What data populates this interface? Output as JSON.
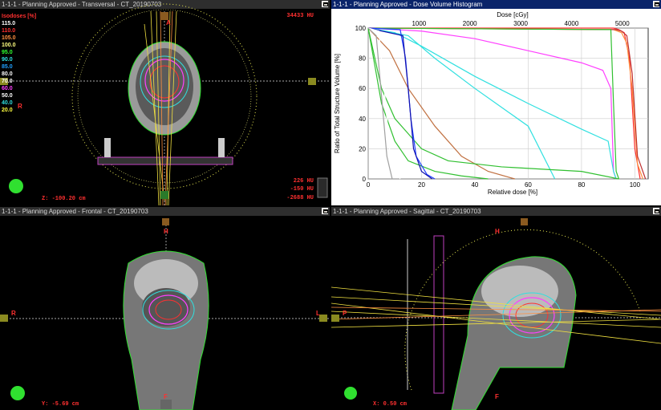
{
  "panels": {
    "transversal": {
      "title": "1-1-1 - Planning Approved - Transversal - CT_20190703",
      "hu_top": "34433 HU",
      "hu1": "226 HU",
      "hu2": "-150 HU",
      "hu3": "-2688 HU",
      "pos": "Z: -100.20 cm",
      "ant": "A",
      "post": "P",
      "right": "R"
    },
    "dvh": {
      "title": "1-1-1 - Planning Approved - Dose Volume Histogram"
    },
    "frontal": {
      "title": "1-1-1 - Planning Approved - Frontal - CT_20190703",
      "pos": "Y: -5.69 cm",
      "top": "H",
      "bottom": "F",
      "left": "R",
      "right": "L"
    },
    "sagittal": {
      "title": "1-1-1 - Planning Approved - Sagittal - CT_20190703",
      "pos": "X: 0.50 cm",
      "top": "H",
      "bottom": "F",
      "left": "P"
    }
  },
  "isodoses": {
    "header": "Isodoses [%]",
    "levels": [
      {
        "v": "115.0",
        "c": "#ffffff"
      },
      {
        "v": "110.0",
        "c": "#ff3030"
      },
      {
        "v": "105.0",
        "c": "#ff9040"
      },
      {
        "v": "100.0",
        "c": "#ffff80"
      },
      {
        "v": "95.0",
        "c": "#30ff30"
      },
      {
        "v": "90.0",
        "c": "#30e0e0"
      },
      {
        "v": "85.0",
        "c": "#20a0ff"
      },
      {
        "v": "80.0",
        "c": "#ffffff"
      },
      {
        "v": "70.0",
        "c": "#ffffff"
      },
      {
        "v": "60.0",
        "c": "#ff40ff"
      },
      {
        "v": "50.0",
        "c": "#ffffff"
      },
      {
        "v": "40.0",
        "c": "#30e0e0"
      },
      {
        "v": "20.0",
        "c": "#ffff40"
      }
    ]
  },
  "chart_data": {
    "type": "line",
    "xlabel": "Relative dose [%]",
    "ylabel": "Ratio of Total Structure Volume [%]",
    "x2label": "Dose [cGy]",
    "xlim": [
      0,
      105
    ],
    "ylim": [
      0,
      100
    ],
    "x_ticks": [
      0,
      20,
      40,
      60,
      80,
      100
    ],
    "y_ticks": [
      0,
      20,
      40,
      60,
      80,
      100
    ],
    "x2_ticks": [
      1000,
      2000,
      3000,
      4000,
      5000
    ],
    "series": [
      {
        "color": "#ff3030",
        "x": [
          0,
          92,
          94,
          96,
          98,
          100,
          102
        ],
        "y": [
          100,
          100,
          99,
          97,
          80,
          20,
          0
        ]
      },
      {
        "color": "#ff9040",
        "x": [
          0,
          92,
          95,
          97,
          99,
          101,
          103
        ],
        "y": [
          100,
          99,
          97,
          90,
          60,
          10,
          0
        ]
      },
      {
        "color": "#c03030",
        "x": [
          0,
          93,
          95,
          97,
          99,
          101,
          104
        ],
        "y": [
          100,
          99,
          98,
          95,
          70,
          15,
          0
        ]
      },
      {
        "color": "#30c030",
        "x": [
          0,
          91,
          92,
          93,
          94
        ],
        "y": [
          100,
          99,
          50,
          5,
          0
        ]
      },
      {
        "color": "#ff40ff",
        "x": [
          0,
          20,
          40,
          60,
          80,
          88,
          91,
          92,
          93
        ],
        "y": [
          100,
          98,
          93,
          85,
          77,
          72,
          60,
          5,
          0
        ]
      },
      {
        "color": "#30e0e0",
        "x": [
          0,
          10,
          20,
          40,
          60,
          80,
          90,
          92,
          93
        ],
        "y": [
          100,
          97,
          88,
          68,
          50,
          33,
          25,
          5,
          0
        ]
      },
      {
        "color": "#30e0e0",
        "x": [
          0,
          15,
          25,
          40,
          60,
          70
        ],
        "y": [
          100,
          95,
          80,
          60,
          35,
          0
        ]
      },
      {
        "color": "#c07040",
        "x": [
          0,
          8,
          15,
          25,
          35,
          45,
          55
        ],
        "y": [
          100,
          85,
          60,
          35,
          15,
          5,
          0
        ]
      },
      {
        "color": "#30c030",
        "x": [
          0,
          5,
          10,
          20,
          30,
          50,
          80,
          94
        ],
        "y": [
          100,
          60,
          40,
          20,
          12,
          8,
          5,
          0
        ]
      },
      {
        "color": "#30c030",
        "x": [
          0,
          5,
          10,
          15,
          25,
          35,
          45
        ],
        "y": [
          100,
          50,
          25,
          12,
          5,
          2,
          0
        ]
      },
      {
        "color": "#2040ff",
        "x": [
          0,
          12,
          14,
          16,
          18,
          22,
          25
        ],
        "y": [
          100,
          99,
          80,
          40,
          15,
          3,
          0
        ]
      },
      {
        "color": "#1010b0",
        "x": [
          0,
          13,
          15,
          17,
          20,
          24
        ],
        "y": [
          100,
          95,
          60,
          20,
          5,
          0
        ]
      },
      {
        "color": "#ffffff",
        "x": [
          0,
          4,
          6,
          8,
          10,
          12
        ],
        "y": [
          100,
          98,
          60,
          20,
          5,
          0
        ]
      },
      {
        "color": "#a0a0a0",
        "x": [
          0,
          3,
          5,
          7,
          9
        ],
        "y": [
          100,
          95,
          55,
          15,
          0
        ]
      }
    ]
  }
}
